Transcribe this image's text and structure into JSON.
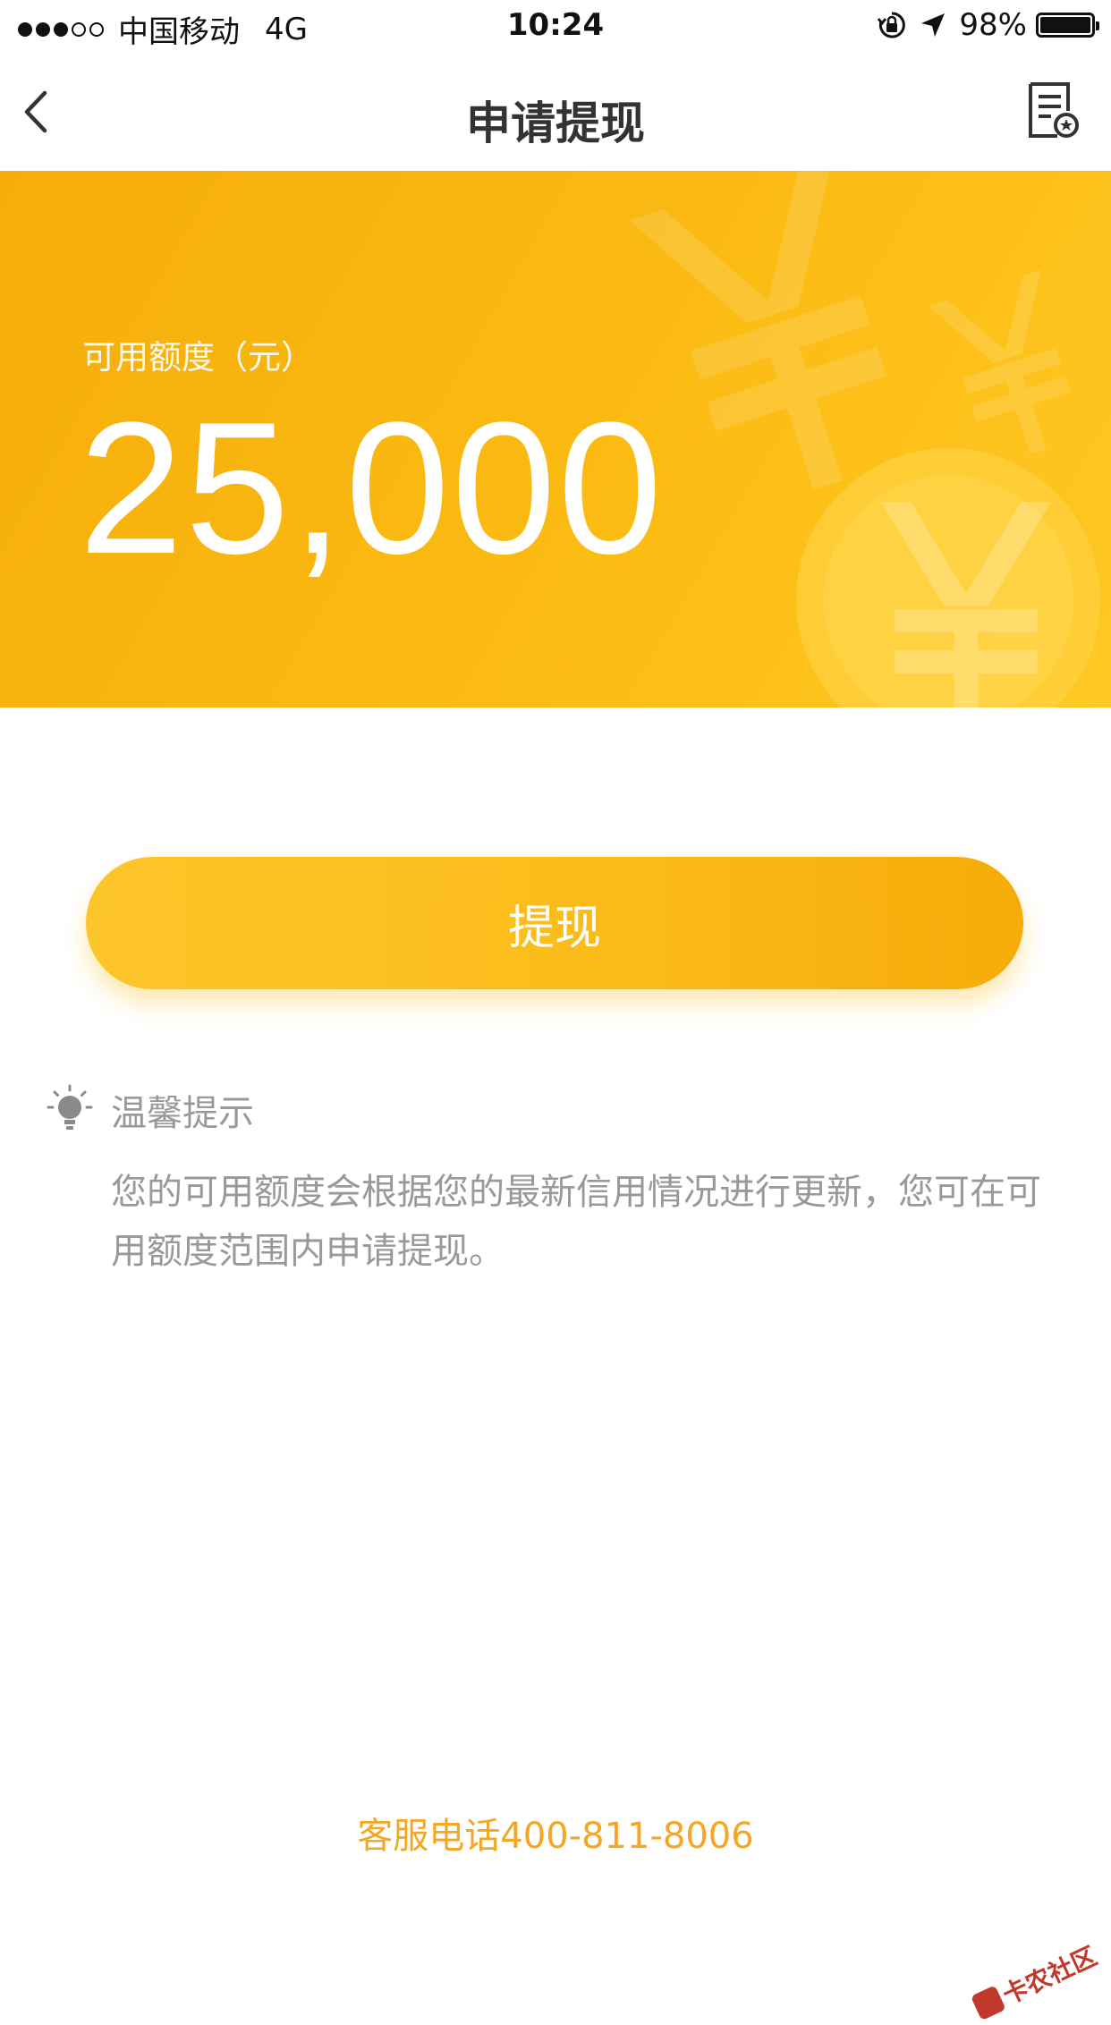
{
  "status_bar": {
    "carrier": "中国移动",
    "network": "4G",
    "time": "10:24",
    "battery": "98%",
    "battery_level": 0.98
  },
  "nav": {
    "title": "申请提现",
    "back_icon": "chevron-left-icon",
    "record_icon": "document-record-icon"
  },
  "banner": {
    "label": "可用额度（元）",
    "amount": "25,000"
  },
  "withdraw_button": {
    "label": "提现"
  },
  "tip": {
    "icon": "lightbulb-icon",
    "title": "温馨提示",
    "body": "您的可用额度会根据您的最新信用情况进行更新，您可在可用额度范围内申请提现。"
  },
  "footer": {
    "hotline": "客服电话400-811-8006",
    "watermark": "卡农社区"
  },
  "colors": {
    "accent": "#fbbc1a",
    "accent_dark": "#f6ab08",
    "hotline": "#f5a623",
    "tip_text": "#999999"
  }
}
